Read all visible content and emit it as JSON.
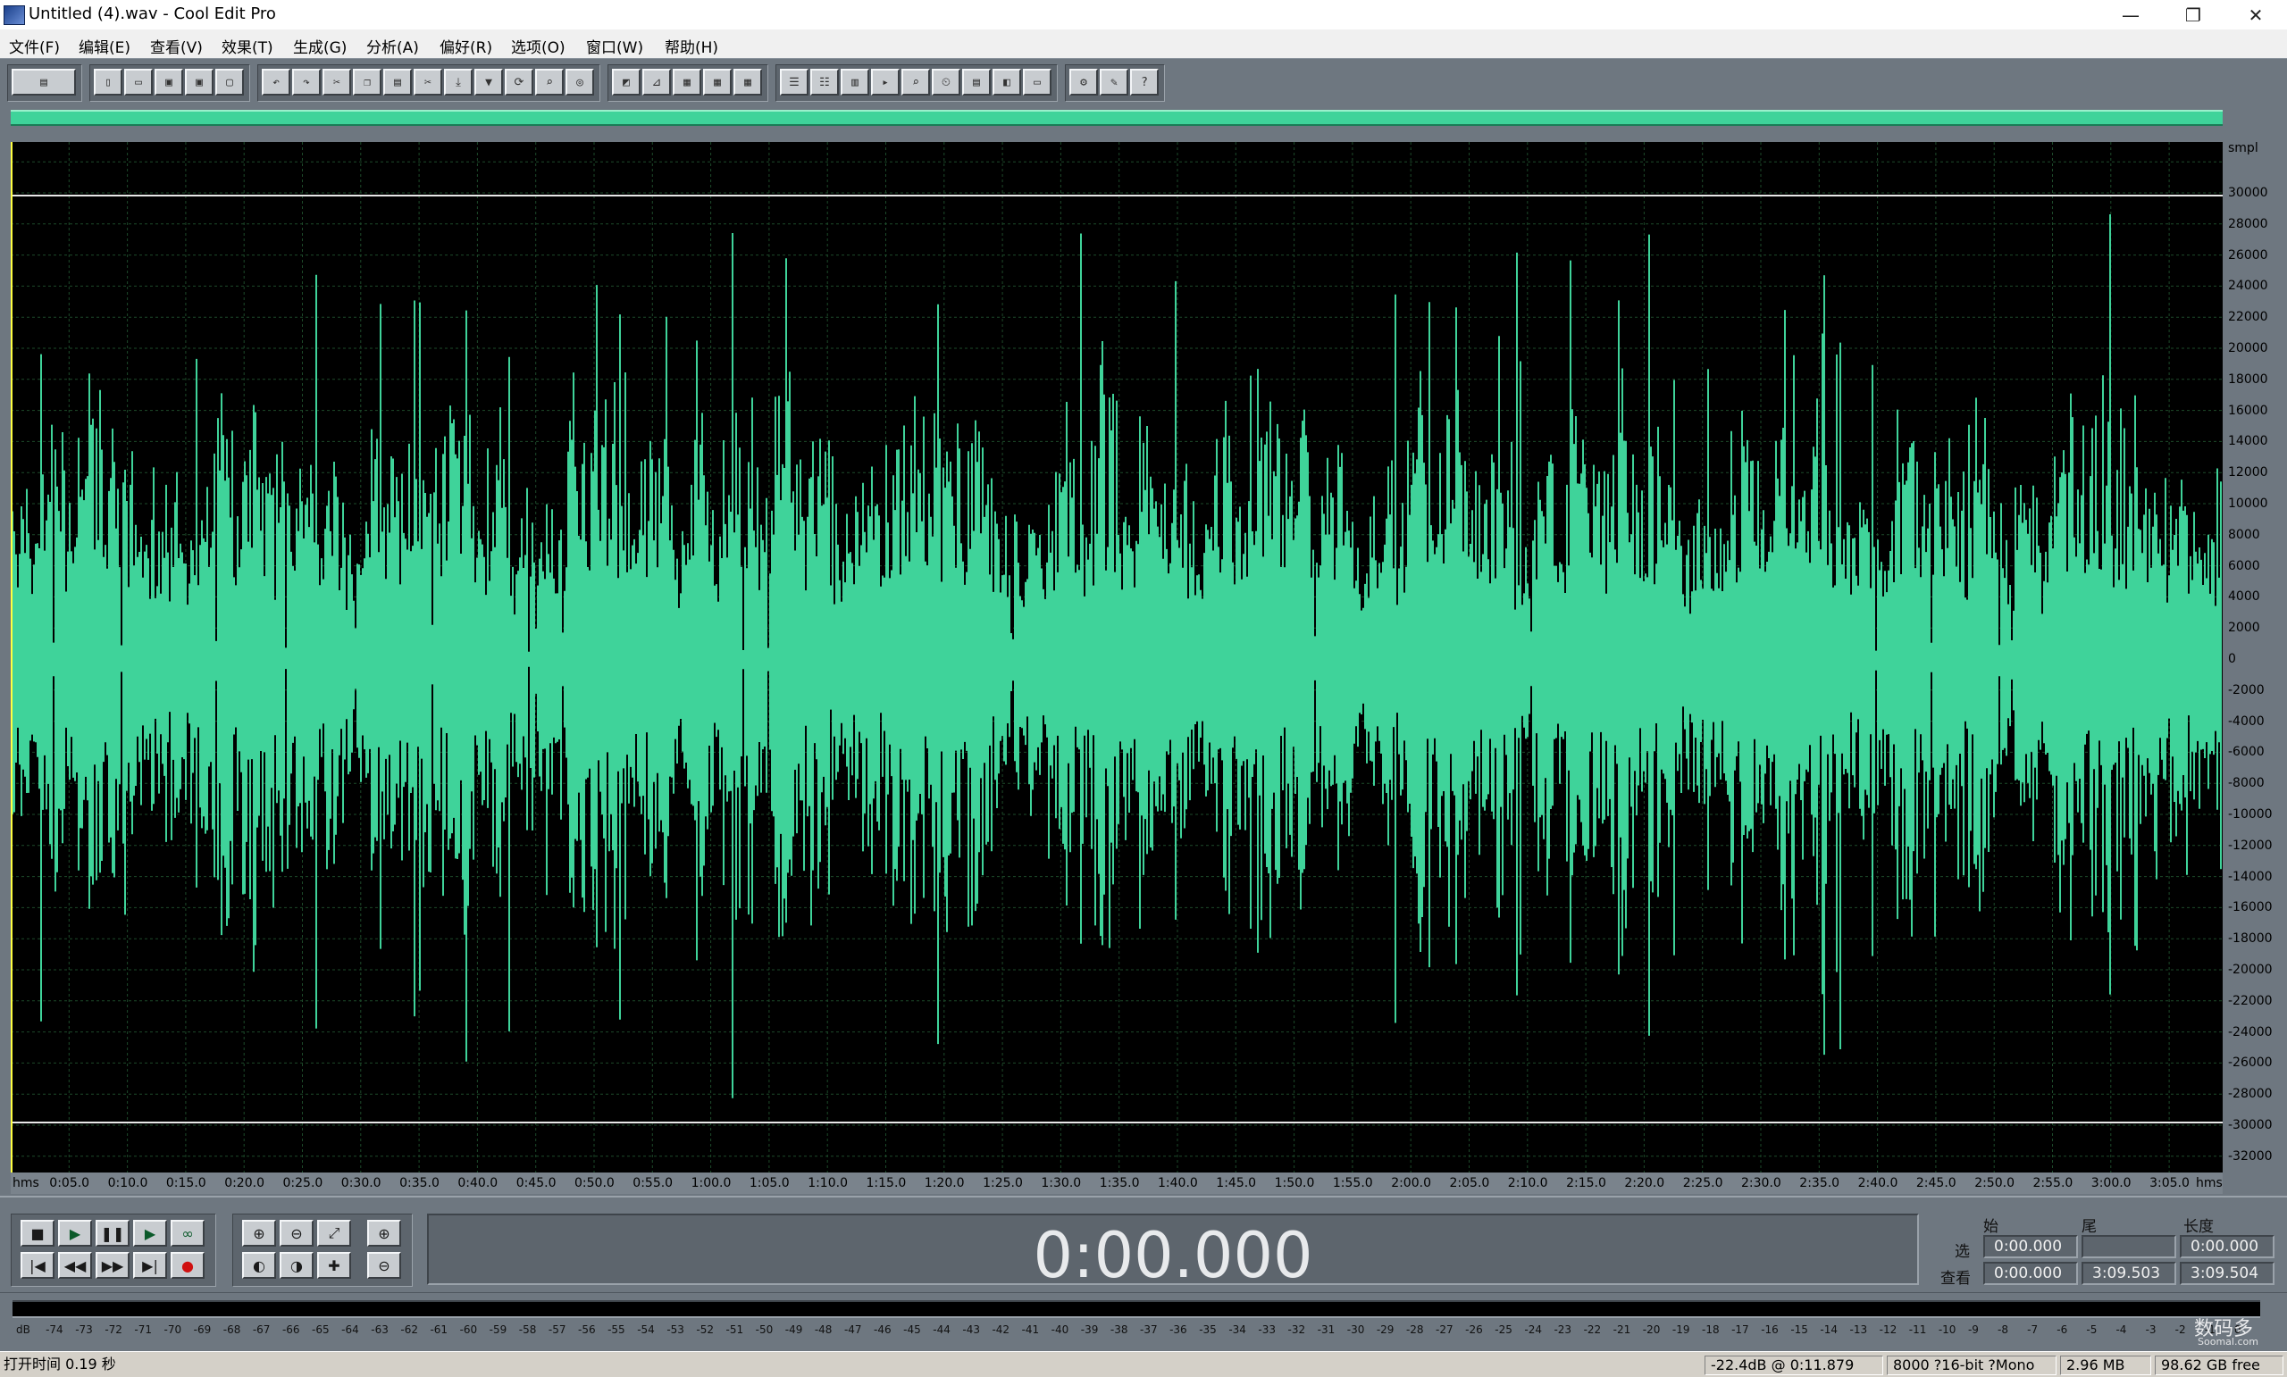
{
  "window": {
    "title": "Untitled (4).wav - Cool Edit Pro",
    "minimize_glyph": "—",
    "restore_glyph": "❐",
    "close_glyph": "✕"
  },
  "menu": [
    "文件(F)",
    "编辑(E)",
    "查看(V)",
    "效果(T)",
    "生成(G)",
    "分析(A)",
    "偏好(R)",
    "选项(O)",
    "窗口(W)",
    "帮助(H)"
  ],
  "toolbar_icons": [
    [
      "multitrack-toggle-icon"
    ],
    [
      "new-file-icon",
      "open-file-icon",
      "save-icon",
      "save-as-icon",
      "close-file-icon"
    ],
    [
      "undo-icon",
      "redo-icon",
      "cut-icon",
      "copy-icon",
      "paste-icon",
      "trim-icon",
      "mix-paste-icon",
      "marker-icon",
      "loop-icon",
      "find-icon",
      "scan-icon"
    ],
    [
      "waveform-view-icon",
      "spectral-view-icon",
      "grid-icon",
      "grid-2-icon",
      "grid-3-icon"
    ],
    [
      "cue-list-icon",
      "play-list-icon",
      "info-icon",
      "play-range-icon",
      "zoom-icon",
      "time-format-icon",
      "data-icon",
      "color-icon",
      "tile-icon"
    ],
    [
      "settings-icon",
      "tips-icon",
      "help-icon"
    ]
  ],
  "colors": {
    "waveform": "#3fd39a",
    "waveform_background": "#000000",
    "grid": "#1d4a2a",
    "panel": "#6e7780"
  },
  "amplitude_axis": {
    "unit_label": "smpl",
    "ticks": [
      "30000",
      "28000",
      "26000",
      "24000",
      "22000",
      "20000",
      "18000",
      "16000",
      "14000",
      "12000",
      "10000",
      "8000",
      "6000",
      "4000",
      "2000",
      "0",
      "-2000",
      "-4000",
      "-6000",
      "-8000",
      "-10000",
      "-12000",
      "-14000",
      "-16000",
      "-18000",
      "-20000",
      "-22000",
      "-24000",
      "-26000",
      "-28000",
      "-30000",
      "-32000"
    ]
  },
  "time_axis": {
    "unit_left": "hms",
    "unit_right": "hms",
    "ticks": [
      "0:05.0",
      "0:10.0",
      "0:15.0",
      "0:20.0",
      "0:25.0",
      "0:30.0",
      "0:35.0",
      "0:40.0",
      "0:45.0",
      "0:50.0",
      "0:55.0",
      "1:00.0",
      "1:05.0",
      "1:10.0",
      "1:15.0",
      "1:20.0",
      "1:25.0",
      "1:30.0",
      "1:35.0",
      "1:40.0",
      "1:45.0",
      "1:50.0",
      "1:55.0",
      "2:00.0",
      "2:05.0",
      "2:10.0",
      "2:15.0",
      "2:20.0",
      "2:25.0",
      "2:30.0",
      "2:35.0",
      "2:40.0",
      "2:45.0",
      "2:50.0",
      "2:55.0",
      "3:00.0",
      "3:05.0"
    ]
  },
  "transport": {
    "stop": "■",
    "play": "▶",
    "pause": "❚❚",
    "play_to_end": "▶",
    "loop": "∞",
    "go_start": "|◀",
    "rewind": "◀◀",
    "fast_forward": "▶▶",
    "go_end": "▶|",
    "record": "●"
  },
  "zoom_buttons": {
    "zoom_in": "⊕",
    "zoom_out": "⊖",
    "zoom_full": "⤢",
    "zoom_in_vertical": "⊕",
    "zoom_left": "◐",
    "zoom_right": "◑",
    "zoom_selection": "✚",
    "zoom_out_vertical": "⊖"
  },
  "time_display": "0:00.000",
  "selection": {
    "headers": {
      "begin": "始",
      "end": "尾",
      "length": "长度"
    },
    "rows": [
      {
        "label": "选",
        "begin": "0:00.000",
        "end": "",
        "length": "0:00.000"
      },
      {
        "label": "查看",
        "begin": "0:00.000",
        "end": "3:09.503",
        "length": "3:09.504"
      }
    ]
  },
  "level_meter": {
    "labels": [
      "dB",
      "-74",
      "-73",
      "-72",
      "-71",
      "-70",
      "-69",
      "-68",
      "-67",
      "-66",
      "-65",
      "-64",
      "-63",
      "-62",
      "-61",
      "-60",
      "-59",
      "-58",
      "-57",
      "-56",
      "-55",
      "-54",
      "-53",
      "-52",
      "-51",
      "-50",
      "-49",
      "-48",
      "-47",
      "-46",
      "-45",
      "-44",
      "-43",
      "-42",
      "-41",
      "-40",
      "-39",
      "-38",
      "-37",
      "-36",
      "-35",
      "-34",
      "-33",
      "-32",
      "-31",
      "-30",
      "-29",
      "-28",
      "-27",
      "-26",
      "-25",
      "-24",
      "-23",
      "-22",
      "-21",
      "-20",
      "-19",
      "-18",
      "-17",
      "-16",
      "-15",
      "-14",
      "-13",
      "-12",
      "-11",
      "-10",
      "-9",
      "-8",
      "-7",
      "-6",
      "-5",
      "-4",
      "-3",
      "-2",
      "-1",
      "0"
    ]
  },
  "status": {
    "open_time": "打开时间  0.19 秒",
    "level_at": "-22.4dB @   0:11.879",
    "format": "8000 ?16-bit ?Mono",
    "size": "2.96 MB",
    "free": "98.62 GB free"
  },
  "watermark": {
    "text": "数码多",
    "url": "Soomal.com"
  }
}
